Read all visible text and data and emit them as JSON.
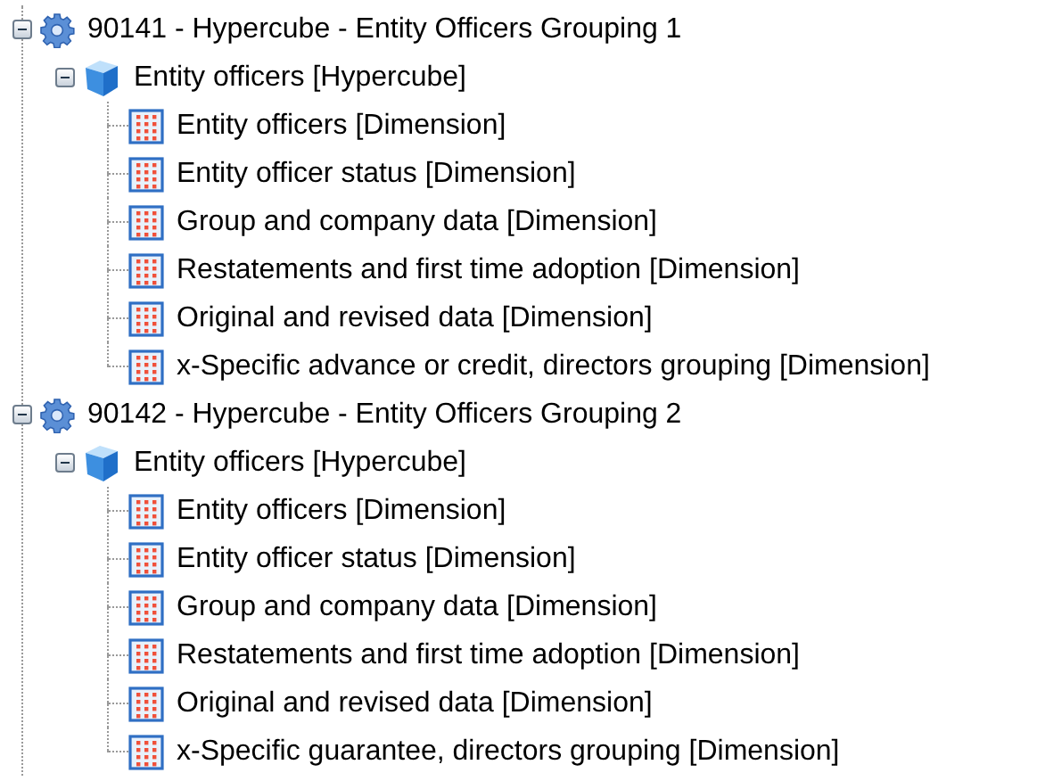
{
  "tree": [
    {
      "label": "90141 - Hypercube - Entity Officers Grouping 1",
      "kind": "group",
      "expanded": true,
      "children": [
        {
          "label": "Entity officers [Hypercube]",
          "kind": "hypercube",
          "expanded": true,
          "children": [
            {
              "label": "Entity officers [Dimension]",
              "kind": "dimension"
            },
            {
              "label": "Entity officer status [Dimension]",
              "kind": "dimension"
            },
            {
              "label": "Group and company data [Dimension]",
              "kind": "dimension"
            },
            {
              "label": "Restatements and first time adoption [Dimension]",
              "kind": "dimension"
            },
            {
              "label": "Original and revised data [Dimension]",
              "kind": "dimension"
            },
            {
              "label": "x-Specific advance or credit, directors grouping [Dimension]",
              "kind": "dimension"
            }
          ]
        }
      ]
    },
    {
      "label": "90142 - Hypercube - Entity Officers Grouping 2",
      "kind": "group",
      "expanded": true,
      "children": [
        {
          "label": "Entity officers [Hypercube]",
          "kind": "hypercube",
          "expanded": true,
          "children": [
            {
              "label": "Entity officers [Dimension]",
              "kind": "dimension"
            },
            {
              "label": "Entity officer status [Dimension]",
              "kind": "dimension"
            },
            {
              "label": "Group and company data [Dimension]",
              "kind": "dimension"
            },
            {
              "label": "Restatements and first time adoption [Dimension]",
              "kind": "dimension"
            },
            {
              "label": "Original and revised data [Dimension]",
              "kind": "dimension"
            },
            {
              "label": "x-Specific guarantee, directors grouping [Dimension]",
              "kind": "dimension"
            }
          ]
        }
      ]
    }
  ]
}
